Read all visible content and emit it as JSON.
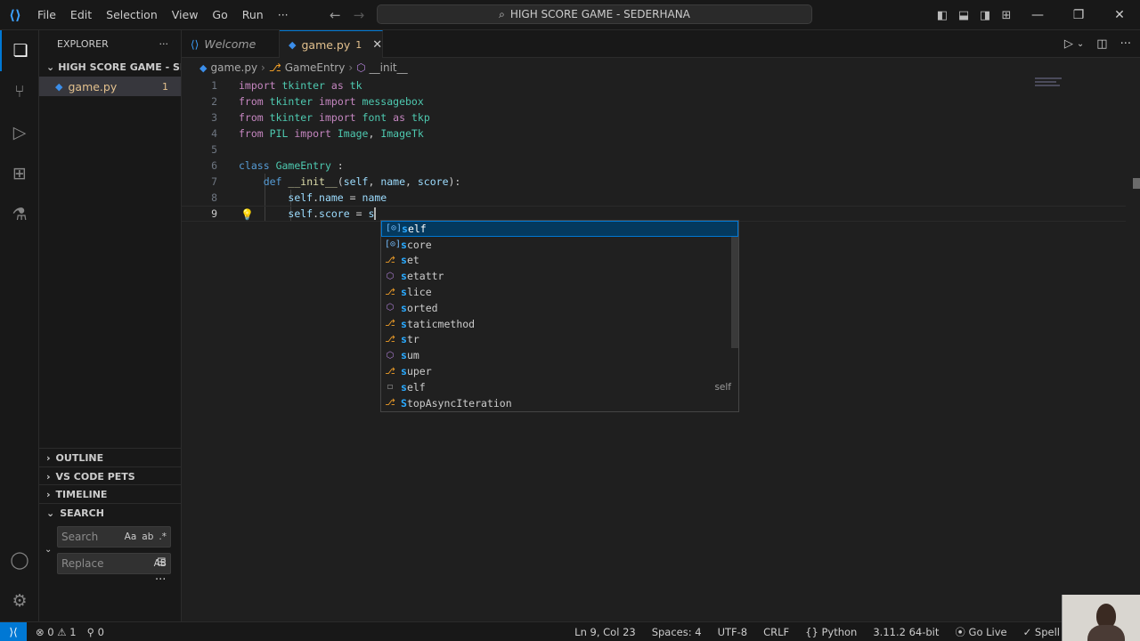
{
  "titlebar": {
    "menu": [
      "File",
      "Edit",
      "Selection",
      "View",
      "Go",
      "Run",
      "···"
    ],
    "command_center": "HIGH SCORE GAME - SEDERHANA"
  },
  "sidebar": {
    "header": "EXPLORER",
    "more": "···",
    "folder": "HIGH SCORE GAME - SEDE...",
    "file": {
      "name": "game.py",
      "badge": "1"
    },
    "sections": {
      "outline": "OUTLINE",
      "pets": "VS CODE PETS",
      "timeline": "TIMELINE",
      "search": "SEARCH"
    },
    "search": {
      "placeholder": "Search",
      "case": "Aa",
      "word": "ab",
      "regex": ".*"
    },
    "replace": {
      "placeholder": "Replace",
      "preserve": "AB"
    }
  },
  "tabs": [
    {
      "label": "Welcome"
    },
    {
      "label": "game.py",
      "badge": "1"
    }
  ],
  "breadcrumbs": [
    "game.py",
    "GameEntry",
    "__init__"
  ],
  "editor": {
    "lines": [
      {
        "n": "1"
      },
      {
        "n": "2"
      },
      {
        "n": "3"
      },
      {
        "n": "4"
      },
      {
        "n": "5"
      },
      {
        "n": "6"
      },
      {
        "n": "7"
      },
      {
        "n": "8"
      },
      {
        "n": "9"
      }
    ]
  },
  "suggest": {
    "items": [
      {
        "label": "self",
        "kind": "var"
      },
      {
        "label": "score",
        "kind": "var"
      },
      {
        "label": "set",
        "kind": "cls"
      },
      {
        "label": "setattr",
        "kind": "fn"
      },
      {
        "label": "slice",
        "kind": "cls"
      },
      {
        "label": "sorted",
        "kind": "fn"
      },
      {
        "label": "staticmethod",
        "kind": "cls"
      },
      {
        "label": "str",
        "kind": "cls"
      },
      {
        "label": "sum",
        "kind": "fn"
      },
      {
        "label": "super",
        "kind": "cls"
      },
      {
        "label": "self",
        "kind": "kw",
        "detail": "self"
      },
      {
        "label": "StopAsyncIteration",
        "kind": "cls"
      }
    ]
  },
  "statusbar": {
    "errors": "0",
    "warnings": "1",
    "ports": "0",
    "position": "Ln 9, Col 23",
    "spaces": "Spaces: 4",
    "encoding": "UTF-8",
    "eol": "CRLF",
    "language": "Python",
    "interpreter": "3.11.2 64-bit",
    "golive": "Go Live",
    "spell": "Spell"
  },
  "colors": {
    "accent": "#0078d4",
    "modified_file": "#e2c08d",
    "keyword": "#c586c0",
    "type": "#4ec9b0"
  }
}
